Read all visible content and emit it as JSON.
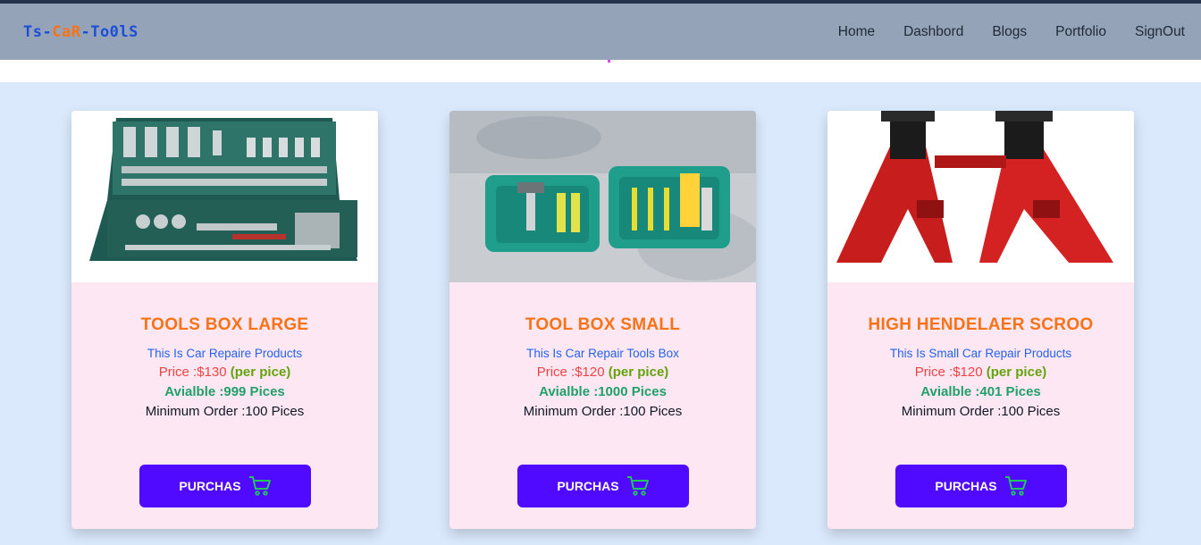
{
  "navbar": {
    "logo": {
      "part1": "Ts",
      "sep1": "-",
      "part2": "CaR",
      "sep2": "-",
      "part3": "To0lS"
    },
    "links": [
      "Home",
      "Dashbord",
      "Blogs",
      "Portfolio",
      "SignOut"
    ]
  },
  "products": [
    {
      "title": "TOOLS BOX LARGE",
      "description": "This Is Car Repaire Products",
      "price_label": "Price :$130",
      "per_label": "(per pice)",
      "available": "Avialble :999 Pices",
      "min_order": "Minimum Order :100 Pices",
      "button": "PURCHAS"
    },
    {
      "title": "TOOL BOX SMALL",
      "description": "This Is Car Repair Tools Box",
      "price_label": "Price :$120",
      "per_label": "(per pice)",
      "available": "Avialble :1000 Pices",
      "min_order": "Minimum Order :100 Pices",
      "button": "PURCHAS"
    },
    {
      "title": "HIGH HENDELAER SCROO",
      "description": "This Is Small Car Repair Products",
      "price_label": "Price :$120",
      "per_label": "(per pice)",
      "available": "Avialble :401 Pices",
      "min_order": "Minimum Order :100 Pices",
      "button": "PURCHAS"
    }
  ],
  "colors": {
    "navbar": "#94a3b8",
    "background": "#dbe9fd",
    "card": "#fce7f3",
    "title": "#f97316",
    "button": "#4f0aff",
    "cart_icon": "#22c55e"
  },
  "icons": {
    "cart": "shopping-cart-icon"
  }
}
